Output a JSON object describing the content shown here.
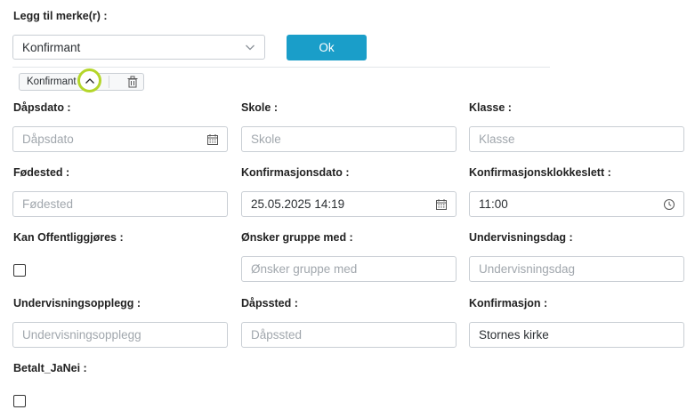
{
  "header": {
    "add_tags_label": "Legg til merke(r) :"
  },
  "tag_select": {
    "value": "Konfirmant",
    "icon": "chevron-down-icon"
  },
  "ok_button": {
    "label": "Ok",
    "color": "#1a9ec9"
  },
  "active_tag": {
    "label": "Konfirmant",
    "collapse_icon": "chevron-up-icon",
    "delete_icon": "trash-icon",
    "highlight_color": "#b4d62a"
  },
  "form": {
    "dapsdato": {
      "label": "Dåpsdato :",
      "placeholder": "Dåpsdato",
      "icon": "calendar-icon"
    },
    "skole": {
      "label": "Skole :",
      "placeholder": "Skole"
    },
    "klasse": {
      "label": "Klasse :",
      "placeholder": "Klasse"
    },
    "fodested": {
      "label": "Fødested :",
      "placeholder": "Fødested"
    },
    "konfirmasjonsdato": {
      "label": "Konfirmasjonsdato :",
      "value": "25.05.2025 14:19",
      "icon": "calendar-icon"
    },
    "konfirmasjonsklokkeslett": {
      "label": "Konfirmasjonsklokkeslett :",
      "value": "11:00",
      "icon": "clock-icon"
    },
    "kan_offentliggjores": {
      "label": "Kan Offentliggjøres :",
      "checked": false
    },
    "onsker_gruppe_med": {
      "label": "Ønsker gruppe med :",
      "placeholder": "Ønsker gruppe med"
    },
    "undervisningsdag": {
      "label": "Undervisningsdag :",
      "placeholder": "Undervisningsdag"
    },
    "undervisningsopplegg": {
      "label": "Undervisningsopplegg :",
      "placeholder": "Undervisningsopplegg"
    },
    "dapssted": {
      "label": "Dåpssted :",
      "placeholder": "Dåpssted"
    },
    "konfirmasjon": {
      "label": "Konfirmasjon :",
      "value": "Stornes kirke"
    },
    "betalt_janei": {
      "label": "Betalt_JaNei :",
      "checked": false
    }
  }
}
